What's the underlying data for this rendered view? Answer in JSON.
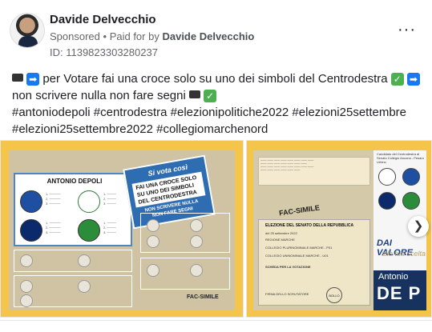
{
  "header": {
    "name": "Davide Delvecchio",
    "sponsored": "Sponsored",
    "paid_for_prefix": "Paid for by",
    "paid_for_by": "Davide Delvecchio",
    "library_id": "ID: 1139823303280237",
    "more_icon": "more-options-icon"
  },
  "post": {
    "line1_text": "per Votare fai una croce solo su uno dei simboli del Centrodestra",
    "line1b_text": "non scrivere nulla non fare segni",
    "hashtags1": "#antoniodepoli #centrodestra #elezionipolitiche2022 #elezioni25settembre",
    "hashtags2": "#elezioni25settembre2022 #collegiomarchenord"
  },
  "carousel": {
    "card1": {
      "candidate": "ANTONIO DEPOLI",
      "callout_title": "Si vota così",
      "callout_text": "FAI UNA CROCE SOLO SU UNO DEI SIMBOLI DEL CENTRODESTRA",
      "callout_bottom": "NON SCRIVERE NULLA NON FARE SEGNI",
      "facsimile": "FAC-SIMILE",
      "logo_fdi": "MELONI",
      "logo_lega": "LEGA SALVINI",
      "logo_fi": "FORZA ITALIA",
      "logo_nm": "NOI MODERATI"
    },
    "card2": {
      "facsimile": "FAC-SIMILE",
      "form_title": "ELEZIONE DEL SENATO DELLA REPUBBLICA",
      "form_date": "del 25 settembre 2022",
      "form_region": "REGIONE MARCHE",
      "form_college": "COLLEGIO PLURINOMINALE MARCHE - P01",
      "form_uninominal": "COLLEGIO UNINOMINALE MARCHE - U01",
      "form_card": "SCHEDA PER LA VOTAZIONE",
      "form_sign": "FIRMA DELLO SCRUTATORE",
      "stamp": "BOLLO",
      "panel_title": "Candidato del Centrodestra al Senato Collegio Ancona - Pesaro Urbino",
      "panel_vote": "DAI VALORE",
      "panel_vote2": "alla tua scelta",
      "panel_first": "Antonio",
      "panel_last": "DE P"
    },
    "next_icon": "chevron-right-icon"
  }
}
